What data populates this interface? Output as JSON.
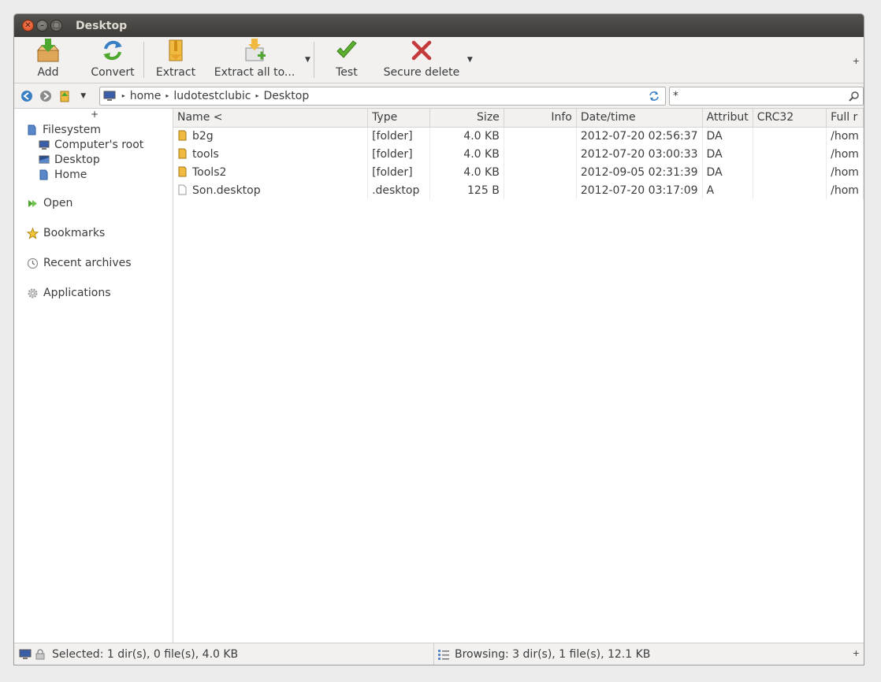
{
  "window": {
    "title": "Desktop"
  },
  "toolbar": {
    "add": "Add",
    "convert": "Convert",
    "extract": "Extract",
    "extract_all": "Extract all to...",
    "test": "Test",
    "secure_delete": "Secure delete",
    "plus": "+"
  },
  "address": {
    "crumbs": [
      "home",
      "ludotestclubic",
      "Desktop"
    ],
    "filter_value": "*"
  },
  "sidebar": {
    "plus": "+",
    "filesystem": "Filesystem",
    "children": [
      "Computer's root",
      "Desktop",
      "Home"
    ],
    "open": "Open",
    "bookmarks": "Bookmarks",
    "recent": "Recent archives",
    "applications": "Applications"
  },
  "columns": [
    "Name <",
    "Type",
    "Size",
    "Info",
    "Date/time",
    "Attribut",
    "CRC32",
    "Full r"
  ],
  "rows": [
    {
      "name": "b2g",
      "type": "[folder]",
      "size": "4.0 KB",
      "info": "",
      "date": "2012-07-20 02:56:37",
      "attr": "DA",
      "crc": "",
      "full": "/hom",
      "kind": "folder"
    },
    {
      "name": "tools",
      "type": "[folder]",
      "size": "4.0 KB",
      "info": "",
      "date": "2012-07-20 03:00:33",
      "attr": "DA",
      "crc": "",
      "full": "/hom",
      "kind": "folder"
    },
    {
      "name": "Tools2",
      "type": "[folder]",
      "size": "4.0 KB",
      "info": "",
      "date": "2012-09-05 02:31:39",
      "attr": "DA",
      "crc": "",
      "full": "/hom",
      "kind": "folder"
    },
    {
      "name": "Son.desktop",
      "type": ".desktop",
      "size": "125 B",
      "info": "",
      "date": "2012-07-20 03:17:09",
      "attr": "A",
      "crc": "",
      "full": "/hom",
      "kind": "file"
    }
  ],
  "status": {
    "selected": "Selected: 1 dir(s), 0 file(s), 4.0 KB",
    "browsing": "Browsing: 3 dir(s), 1 file(s), 12.1 KB",
    "plus": "+"
  }
}
